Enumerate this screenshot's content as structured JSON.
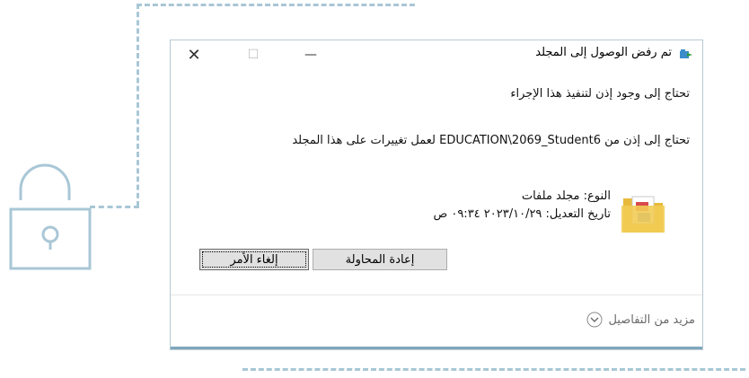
{
  "window": {
    "title": "تم رفض الوصول إلى المجلد",
    "minimize_glyph": "—",
    "maximize_glyph": "☐",
    "close_glyph": "✕"
  },
  "message": {
    "heading": "تحتاج إلى وجود إذن لتنفيذ هذا الإجراء",
    "permission": "تحتاج إلى إذن من EDUCATION\\2069_Student6 لعمل تغييرات على هذا المجلد"
  },
  "item": {
    "icon": "folder-icon",
    "type_line": "النوع: مجلد ملفات",
    "modified_line": "تاريخ التعديل: ٢٠٢٣/١٠/٢٩ ٠٩:٣٤ ص"
  },
  "buttons": {
    "retry": "إعادة المحاولة",
    "cancel": "إلغاء الأمر"
  },
  "footer": {
    "more_details": "مزيد من التفاصيل",
    "icon": "chevron-down-circle-icon"
  },
  "colors": {
    "accent": "#7fa7bd",
    "decoration": "#a9c7d6"
  }
}
